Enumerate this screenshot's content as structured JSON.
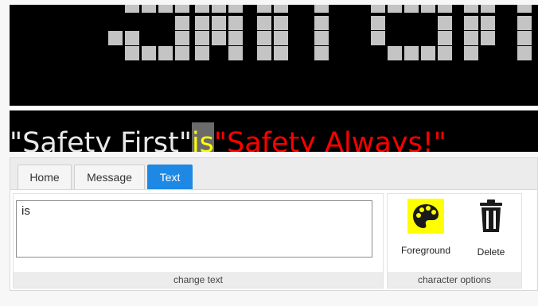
{
  "message_preview": {
    "segments": [
      {
        "text": "\"Safety First\"",
        "color": "#e9e9e9"
      },
      {
        "text": " ",
        "color": "#e9e9e9"
      },
      {
        "text": " is ",
        "color": "#ffff00",
        "highlight": "#6b6b6b"
      },
      {
        "text": "\"Safety Always!\"",
        "color": "#ff0000"
      }
    ]
  },
  "led_display": {
    "background": "#000000",
    "pixel_color": "#c4c4c4"
  },
  "tabs": [
    {
      "label": "Home",
      "active": false
    },
    {
      "label": "Message",
      "active": false
    },
    {
      "label": "Text",
      "active": true
    }
  ],
  "text_group": {
    "value": "is",
    "caption": "change text"
  },
  "character_group": {
    "caption": "character options",
    "foreground": {
      "label": "Foreground",
      "icon": "palette-icon",
      "icon_background": "#ffff00"
    },
    "delete": {
      "label": "Delete",
      "icon": "trash-icon"
    }
  },
  "colors": {
    "accent": "#1e88e5"
  }
}
